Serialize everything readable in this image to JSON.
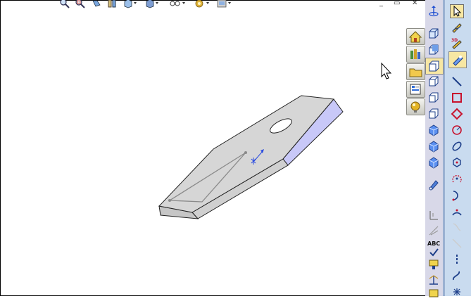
{
  "app": {
    "window_controls": {
      "minimize": "_",
      "restore": "▭",
      "close": "✕"
    }
  },
  "top_toolbar": {
    "buttons": [
      {
        "name": "zoom-to-fit-icon"
      },
      {
        "name": "zoom-to-area-icon"
      },
      {
        "name": "previous-view-icon"
      },
      {
        "name": "section-view-icon"
      },
      {
        "name": "view-orientation-icon"
      },
      {
        "name": "display-style-icon"
      },
      {
        "name": "hide-show-items-icon"
      },
      {
        "name": "edit-appearance-icon"
      },
      {
        "name": "apply-scene-icon"
      }
    ]
  },
  "task_pane": {
    "tabs": [
      {
        "name": "home-icon"
      },
      {
        "name": "design-library-icon"
      },
      {
        "name": "file-explorer-icon"
      },
      {
        "name": "view-palette-icon"
      },
      {
        "name": "appearances-icon"
      }
    ]
  },
  "view_toolbar": {
    "buttons": [
      "coordinate-axis-icon",
      "front-view-icon",
      "back-view-icon",
      "left-view-icon",
      "right-view-icon",
      "top-view-icon",
      "bottom-view-icon",
      "isometric-view-icon",
      "trimetric-view-icon",
      "dimetric-view-icon",
      "normal-to-icon",
      "single-view-icon",
      "two-view-icon",
      "four-view-icon"
    ]
  },
  "sketch_toolbar": {
    "abc_label": "ABC",
    "buttons": [
      "select-icon",
      "sketch-icon",
      "3d-sketch-icon",
      "smart-dimension-icon",
      "line-icon",
      "rectangle-icon",
      "polygon-icon",
      "circle-icon",
      "ellipse-icon",
      "centerpoint-arc-icon",
      "tangent-arc-icon",
      "3-point-arc-icon",
      "spline-icon"
    ]
  },
  "model": {
    "part": "isometric-plate-with-slot",
    "body_color": "#d3d3d3",
    "side_color": "#c8c8f8"
  }
}
